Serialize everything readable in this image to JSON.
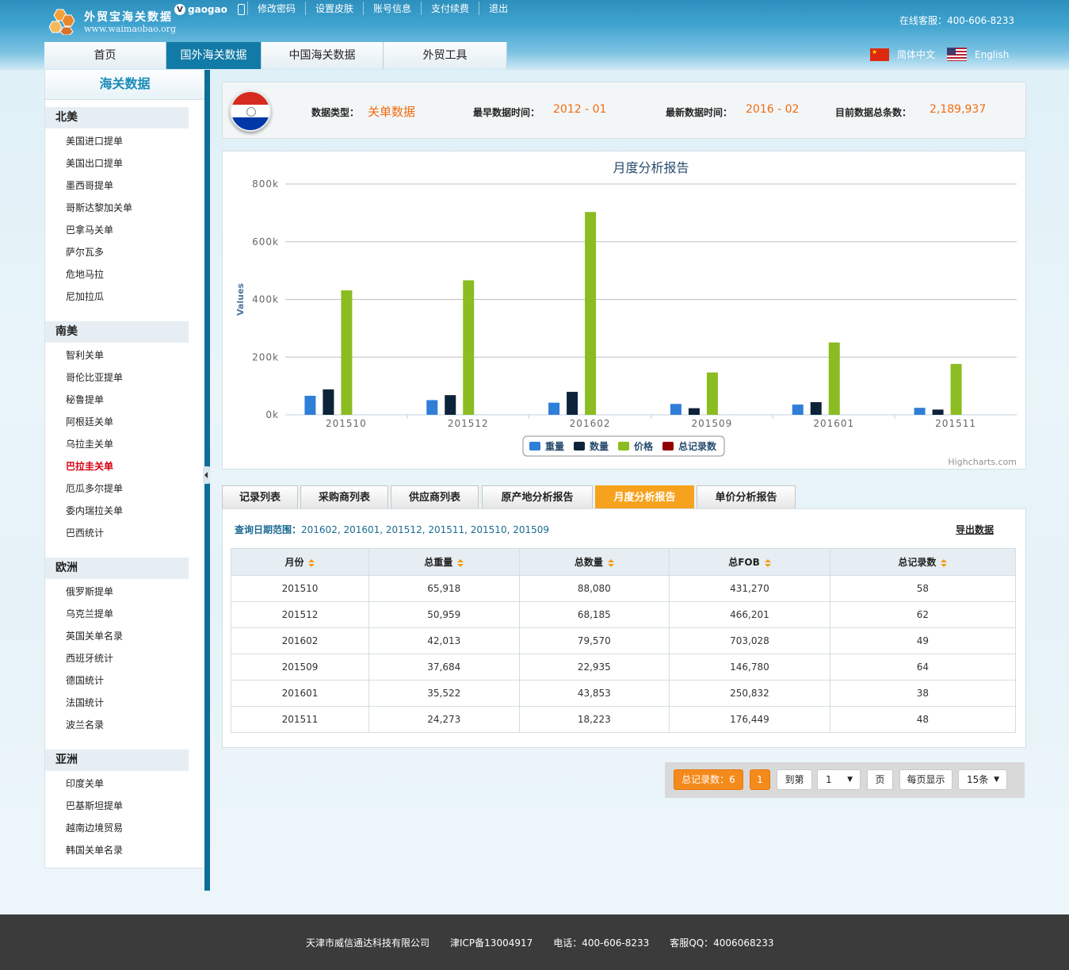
{
  "header": {
    "logo_title": "外贸宝海关数据",
    "logo_url": "www.waimaobao.org",
    "vip_badge": "V",
    "username": "gaogao",
    "top_links": [
      "修改密码",
      "设置皮肤",
      "账号信息",
      "支付续费",
      "退出"
    ],
    "hotline": "在线客服：400-606-8233",
    "lang_cn": "简体中文",
    "lang_en": "English"
  },
  "nav": {
    "tabs": [
      "首页",
      "国外海关数据",
      "中国海关数据",
      "外贸工具"
    ],
    "active_index": 1
  },
  "sidebar": {
    "title": "海关数据",
    "regions": [
      {
        "name": "北美",
        "items": [
          "美国进口提单",
          "美国出口提单",
          "墨西哥提单",
          "哥斯达黎加关单",
          "巴拿马关单",
          "萨尔瓦多",
          "危地马拉",
          "尼加拉瓜"
        ]
      },
      {
        "name": "南美",
        "items": [
          "智利关单",
          "哥伦比亚提单",
          "秘鲁提单",
          "阿根廷关单",
          "乌拉圭关单",
          "巴拉圭关单",
          "厄瓜多尔提单",
          "委内瑞拉关单",
          "巴西统计"
        ]
      },
      {
        "name": "欧洲",
        "items": [
          "俄罗斯提单",
          "乌克兰提单",
          "英国关单名录",
          "西班牙统计",
          "德国统计",
          "法国统计",
          "波兰名录"
        ]
      },
      {
        "name": "亚洲",
        "items": [
          "印度关单",
          "巴基斯坦提单",
          "越南边境贸易",
          "韩国关单名录"
        ]
      }
    ],
    "current_item": "巴拉圭关单"
  },
  "info": {
    "type_label": "数据类型：",
    "type_value": "关单数据",
    "earliest_label": "最早数据时间：",
    "earliest_value": "2012 - 01",
    "latest_label": "最新数据时间：",
    "latest_value": "2016 - 02",
    "total_label": "目前数据总条数：",
    "total_value": "2,189,937"
  },
  "chart_data": {
    "type": "bar",
    "title": "月度分析报告",
    "ylabel": "Values",
    "xlabel": "",
    "ylim": [
      0,
      800000
    ],
    "yticks": [
      "0k",
      "200k",
      "400k",
      "600k",
      "800k"
    ],
    "categories": [
      "201510",
      "201512",
      "201602",
      "201509",
      "201601",
      "201511"
    ],
    "series": [
      {
        "name": "重量",
        "color": "#2f7ed8",
        "values": [
          65918,
          50959,
          42013,
          37684,
          35522,
          24273
        ]
      },
      {
        "name": "数量",
        "color": "#0d233a",
        "values": [
          88080,
          68185,
          79570,
          22935,
          43853,
          18223
        ]
      },
      {
        "name": "价格",
        "color": "#8bbc21",
        "values": [
          431270,
          466201,
          703028,
          146780,
          250832,
          176449
        ]
      },
      {
        "name": "总记录数",
        "color": "#910000",
        "values": [
          58,
          62,
          49,
          64,
          38,
          48
        ]
      }
    ],
    "grid": true,
    "legend_position": "bottom-center",
    "credit": "Highcharts.com"
  },
  "tabs": {
    "items": [
      "记录列表",
      "采购商列表",
      "供应商列表",
      "原产地分析报告",
      "月度分析报告",
      "单价分析报告"
    ],
    "active_index": 4
  },
  "report": {
    "range_label": "查询日期范围：",
    "range_value": "201602, 201601, 201512, 201511, 201510, 201509",
    "export_label": "导出数据",
    "columns": [
      "月份",
      "总重量",
      "总数量",
      "总FOB",
      "总记录数"
    ],
    "rows": [
      [
        "201510",
        "65,918",
        "88,080",
        "431,270",
        "58"
      ],
      [
        "201512",
        "50,959",
        "68,185",
        "466,201",
        "62"
      ],
      [
        "201602",
        "42,013",
        "79,570",
        "703,028",
        "49"
      ],
      [
        "201509",
        "37,684",
        "22,935",
        "146,780",
        "64"
      ],
      [
        "201601",
        "35,522",
        "43,853",
        "250,832",
        "38"
      ],
      [
        "201511",
        "24,273",
        "18,223",
        "176,449",
        "48"
      ]
    ]
  },
  "pager": {
    "total_label": "总记录数：6",
    "current_page": "1",
    "goto_label": "到第",
    "page_select": "1",
    "page_unit": "页",
    "per_page_label": "每页显示",
    "per_page_select": "15条"
  },
  "footer": {
    "items": [
      "天津市威信通达科技有限公司",
      "津ICP备13004917",
      "电话：400-606-8233",
      "客服QQ：4006068233"
    ]
  }
}
